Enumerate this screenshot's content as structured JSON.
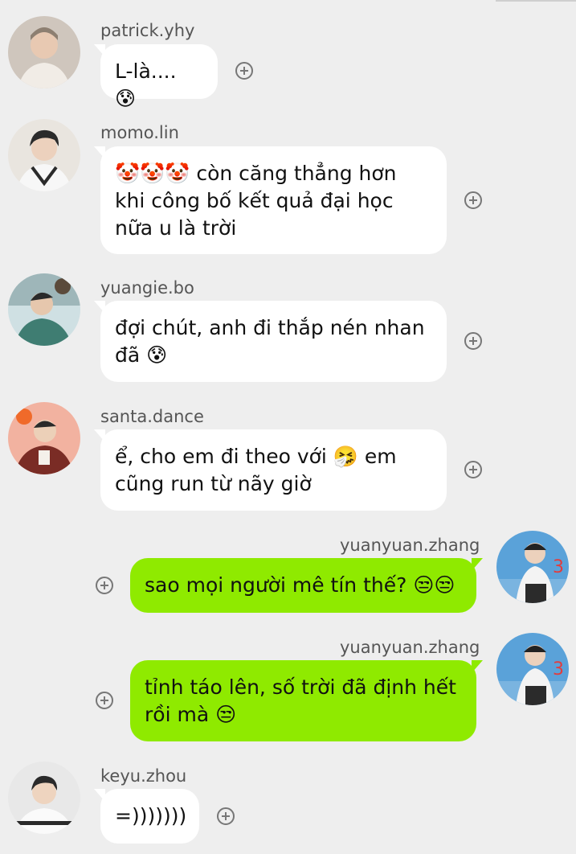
{
  "messages": [
    {
      "username": "patrick.yhy",
      "text": "L-là.... 😰",
      "direction": "incoming",
      "avatar_icon": "avatar-photo",
      "avatar_colors": [
        "#cfc6bd",
        "#8d7f71"
      ]
    },
    {
      "username": "momo.lin",
      "text": "🤡🤡🤡 còn căng thẳng hơn khi công bố kết quả đại học nữa u là trời",
      "direction": "incoming",
      "avatar_icon": "avatar-photo",
      "avatar_colors": [
        "#e9e5df",
        "#2b2b2b"
      ]
    },
    {
      "username": "yuangie.bo",
      "text": "đợi chút, anh đi thắp nén nhan đã 😰",
      "direction": "incoming",
      "avatar_icon": "avatar-photo",
      "avatar_colors": [
        "#cfe0e3",
        "#3f7d72"
      ]
    },
    {
      "username": "santa.dance",
      "text": "ể, cho em đi theo với 🤧 em cũng run từ nãy giờ",
      "direction": "incoming",
      "avatar_icon": "avatar-photo",
      "avatar_colors": [
        "#f2b2a0",
        "#7a2c25"
      ]
    },
    {
      "username": "yuanyuan.zhang",
      "text": "sao mọi người mê tín thế? 😒😒",
      "direction": "outgoing",
      "avatar_icon": "avatar-photo",
      "avatar_colors": [
        "#5aa2d9",
        "#f3f3f3"
      ]
    },
    {
      "username": "yuanyuan.zhang",
      "text": "tỉnh táo lên, số trời đã định hết rồi mà 😒",
      "direction": "outgoing",
      "avatar_icon": "avatar-photo",
      "avatar_colors": [
        "#5aa2d9",
        "#f3f3f3"
      ]
    },
    {
      "username": "keyu.zhou",
      "text": "=)))))))",
      "direction": "incoming",
      "avatar_icon": "avatar-photo",
      "avatar_colors": [
        "#e8e8e8",
        "#2a2a2a"
      ]
    }
  ],
  "colors": {
    "background": "#eeeeee",
    "incoming_bubble": "#ffffff",
    "outgoing_bubble": "#8fea00",
    "username": "#555555",
    "plus_icon": "#777777"
  }
}
